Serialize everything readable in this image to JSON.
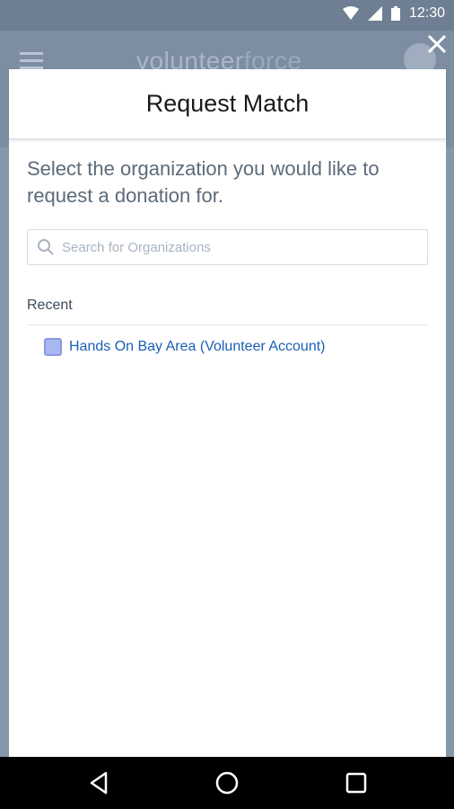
{
  "status_bar": {
    "time": "12:30",
    "icons": [
      "wifi-icon",
      "signal-icon",
      "battery-icon"
    ]
  },
  "app": {
    "brand_part1": "volunteer",
    "brand_part2": "force"
  },
  "modal": {
    "title": "Request Match",
    "instructions": "Select the organization you would like to request a donation for.",
    "search": {
      "placeholder": "Search for Organizations",
      "value": ""
    },
    "section_label": "Recent",
    "recent_items": [
      {
        "label": "Hands On Bay Area (Volunteer Account)"
      }
    ]
  },
  "nav": {
    "icons": [
      "back-icon",
      "home-icon",
      "recents-icon"
    ]
  },
  "colors": {
    "link": "#1a5fb4",
    "org_icon": "#a9b7f0",
    "overlay": "#8797ab"
  }
}
